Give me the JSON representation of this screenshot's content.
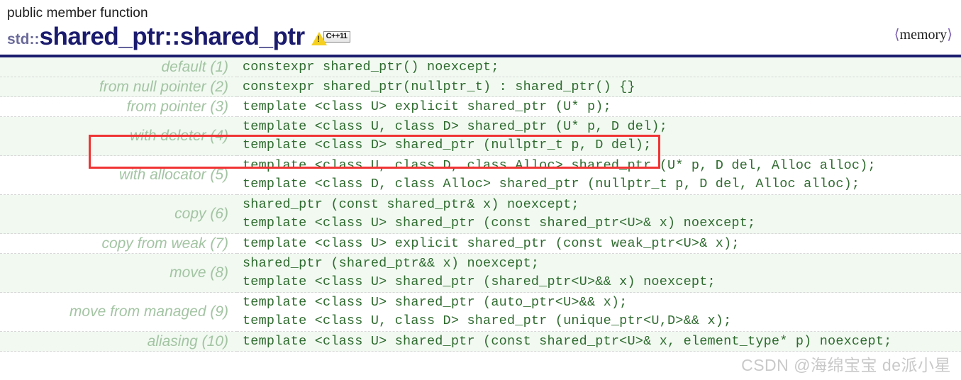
{
  "header": {
    "kind": "public member function",
    "namespace": "std::",
    "title": "shared_ptr::shared_ptr",
    "warning_icon": "warning-triangle-icon",
    "standard_badge": "C++11",
    "include_open": "⟨",
    "include_name": "memory",
    "include_close": "⟩",
    "rule_color": "#1b1b6e"
  },
  "colors": {
    "title": "#1b1b6e",
    "namespace": "#6a6a9a",
    "label": "#a3c4a3",
    "code": "#2f6b2f",
    "alt_row_bg": "#f1f9f1",
    "highlight_border": "#f03434",
    "watermark": "#c9c9c9"
  },
  "table": {
    "rows": [
      {
        "label": "default (1)",
        "lines": [
          "constexpr shared_ptr() noexcept;"
        ],
        "shade": "alt",
        "highlighted": false
      },
      {
        "label": "from null pointer (2)",
        "lines": [
          "constexpr shared_ptr(nullptr_t) : shared_ptr() {}"
        ],
        "shade": "alt",
        "highlighted": false
      },
      {
        "label": "from pointer (3)",
        "lines": [
          "template <class U> explicit shared_ptr (U* p);"
        ],
        "shade": "plain",
        "highlighted": false
      },
      {
        "label": "with deleter (4)",
        "lines": [
          "template <class U, class D> shared_ptr (U* p, D del);",
          "template <class D> shared_ptr (nullptr_t p, D del);"
        ],
        "shade": "alt",
        "highlighted": true
      },
      {
        "label": "with allocator (5)",
        "lines": [
          "template <class U, class D, class Alloc> shared_ptr (U* p, D del, Alloc alloc);",
          "template <class D, class Alloc> shared_ptr (nullptr_t p, D del, Alloc alloc);"
        ],
        "shade": "plain",
        "highlighted": false
      },
      {
        "label": "copy (6)",
        "lines": [
          "shared_ptr (const shared_ptr& x) noexcept;",
          "template <class U> shared_ptr (const shared_ptr<U>& x) noexcept;"
        ],
        "shade": "alt",
        "highlighted": false
      },
      {
        "label": "copy from weak (7)",
        "lines": [
          "template <class U> explicit shared_ptr (const weak_ptr<U>& x);"
        ],
        "shade": "plain",
        "highlighted": false
      },
      {
        "label": "move (8)",
        "lines": [
          "shared_ptr (shared_ptr&& x) noexcept;",
          "template <class U> shared_ptr (shared_ptr<U>&& x) noexcept;"
        ],
        "shade": "alt",
        "highlighted": false
      },
      {
        "label": "move from managed (9)",
        "lines": [
          "template <class U> shared_ptr (auto_ptr<U>&& x);",
          "template <class U, class D> shared_ptr (unique_ptr<U,D>&& x);"
        ],
        "shade": "plain",
        "highlighted": false
      },
      {
        "label": "aliasing (10)",
        "lines": [
          "template <class U> shared_ptr (const shared_ptr<U>& x, element_type* p) noexcept;"
        ],
        "shade": "alt",
        "highlighted": false
      }
    ]
  },
  "watermark": {
    "text": "CSDN @海绵宝宝 de派小星"
  }
}
